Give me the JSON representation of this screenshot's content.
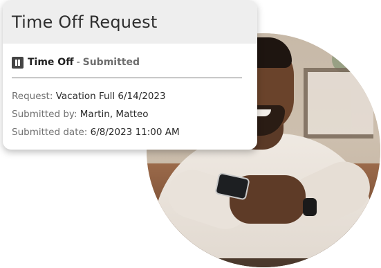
{
  "card": {
    "title": "Time Off Request",
    "status": {
      "icon": "pause-icon",
      "type": "Time Off",
      "separator": "-",
      "value": "Submitted"
    },
    "details": [
      {
        "label": "Request:",
        "value": "Vacation Full 6/14/2023"
      },
      {
        "label": "Submitted by:",
        "value": "Martin, Matteo"
      },
      {
        "label": "Submitted date:",
        "value": "6/8/2023 11:00 AM"
      }
    ]
  },
  "colors": {
    "header_bg": "#eeeeee",
    "status_muted": "#6d6d6d"
  }
}
